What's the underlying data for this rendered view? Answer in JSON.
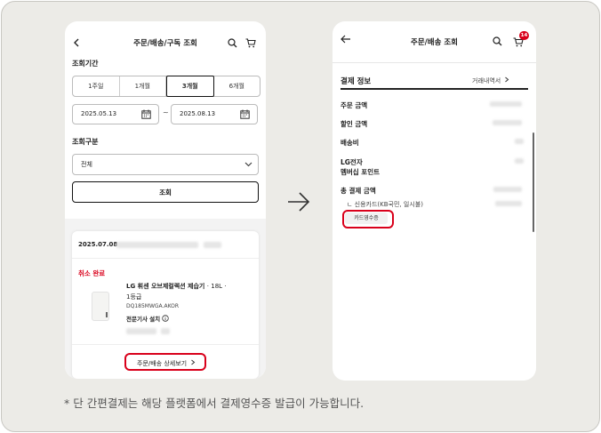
{
  "footnote": "* 단 간편결제는 해당 플랫폼에서 결제영수증 발급이 가능합니다.",
  "left_screen": {
    "header_title": "주문/배송/구독 조회",
    "period_label": "조회기간",
    "period_options": [
      "1주일",
      "1개월",
      "3개월",
      "6개월"
    ],
    "selected_period": "3개월",
    "start_date": "2025.05.13",
    "date_separator": "~",
    "end_date": "2025.08.13",
    "category_label": "조회구분",
    "category_value": "전체",
    "search_button": "조회",
    "order": {
      "date": "2025.07.08",
      "status": "취소 완료",
      "product_name": "LG 휘센 오브제컬렉션 제습기",
      "product_capacity": "· 18L ·",
      "product_grade": "1등급",
      "model": "DQ185MWGA.AKOR",
      "install_note": "전문기사 설치",
      "detail_button": "주문/배송 상세보기"
    }
  },
  "right_screen": {
    "header_title": "주문/배송 조회",
    "cart_badge": "14",
    "section_title": "결제 정보",
    "history_link": "거래내역서",
    "rows": [
      "주문 금액",
      "할인 금액",
      "배송비",
      "LG전자",
      "멤버십 포인트",
      "총 결제 금액"
    ],
    "payment_method": "신용카드(KB국민, 일시불)",
    "receipt_button": "카드영수증"
  },
  "colors": {
    "accent_red": "#d9001b",
    "frame_bg": "#ecebe7"
  },
  "icons": [
    "back-chevron-icon",
    "back-arrow-icon",
    "search-icon",
    "cart-icon",
    "calendar-icon",
    "chevron-down-icon",
    "chevron-right-icon",
    "info-icon",
    "arrow-right-icon"
  ]
}
